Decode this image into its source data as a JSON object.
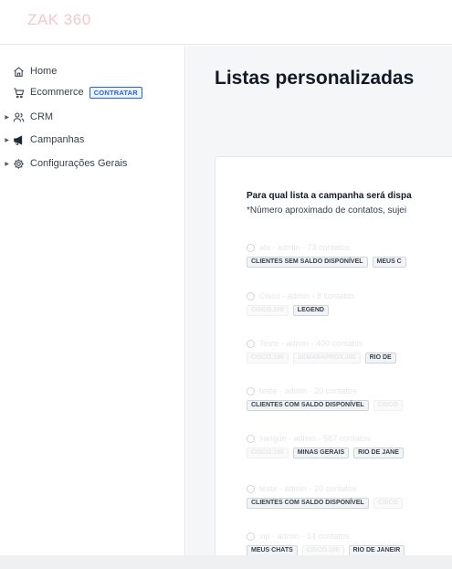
{
  "app": {
    "logo": "ZAK 360"
  },
  "sidebar": {
    "items": [
      {
        "label": "Home",
        "icon": "home-icon"
      },
      {
        "label": "Ecommerce",
        "icon": "cart-icon",
        "badge": "CONTRATAR"
      },
      {
        "label": "CRM",
        "icon": "users-icon"
      },
      {
        "label": "Campanhas",
        "icon": "megaphone-icon"
      },
      {
        "label": "Configurações Gerais",
        "icon": "gear-icon"
      }
    ]
  },
  "main": {
    "title": "Listas personalizadas",
    "question": "Para qual lista a campanha será dispa",
    "note": "*Número aproximado de contatos, sujei",
    "options": [
      {
        "label": "abi - admin - 73 contatos",
        "tags": [
          "CLIENTES SEM SALDO DISPONÍVEL",
          "MEUS C"
        ]
      },
      {
        "label": "Cisco - admin - 8 contatos",
        "tags": [
          "CISCO.100",
          "LEGEND"
        ]
      },
      {
        "label": "Teste - admin - 400 contatos",
        "tags": [
          "CISCO.100",
          "SEMANAPROX.001",
          "RIO DE"
        ]
      },
      {
        "label": "teste - admin - 20 contatos",
        "tags": [
          "CLIENTES COM SALDO DISPONÍVEL",
          "CISCO"
        ]
      },
      {
        "label": "sangue - admin - 587 contatos",
        "tags": [
          "CISCO.100",
          "MINAS GERAIS",
          "RIO DE JANE"
        ]
      },
      {
        "label": "teste - admin - 20 contatos",
        "tags": [
          "CLIENTES COM SALDO DISPONÍVEL",
          "CISCO"
        ]
      },
      {
        "label": "vip - admin - 14 contatos",
        "tags": [
          "MEUS CHATS",
          "CISCO.100",
          "RIO DE JANEIR"
        ]
      }
    ]
  }
}
